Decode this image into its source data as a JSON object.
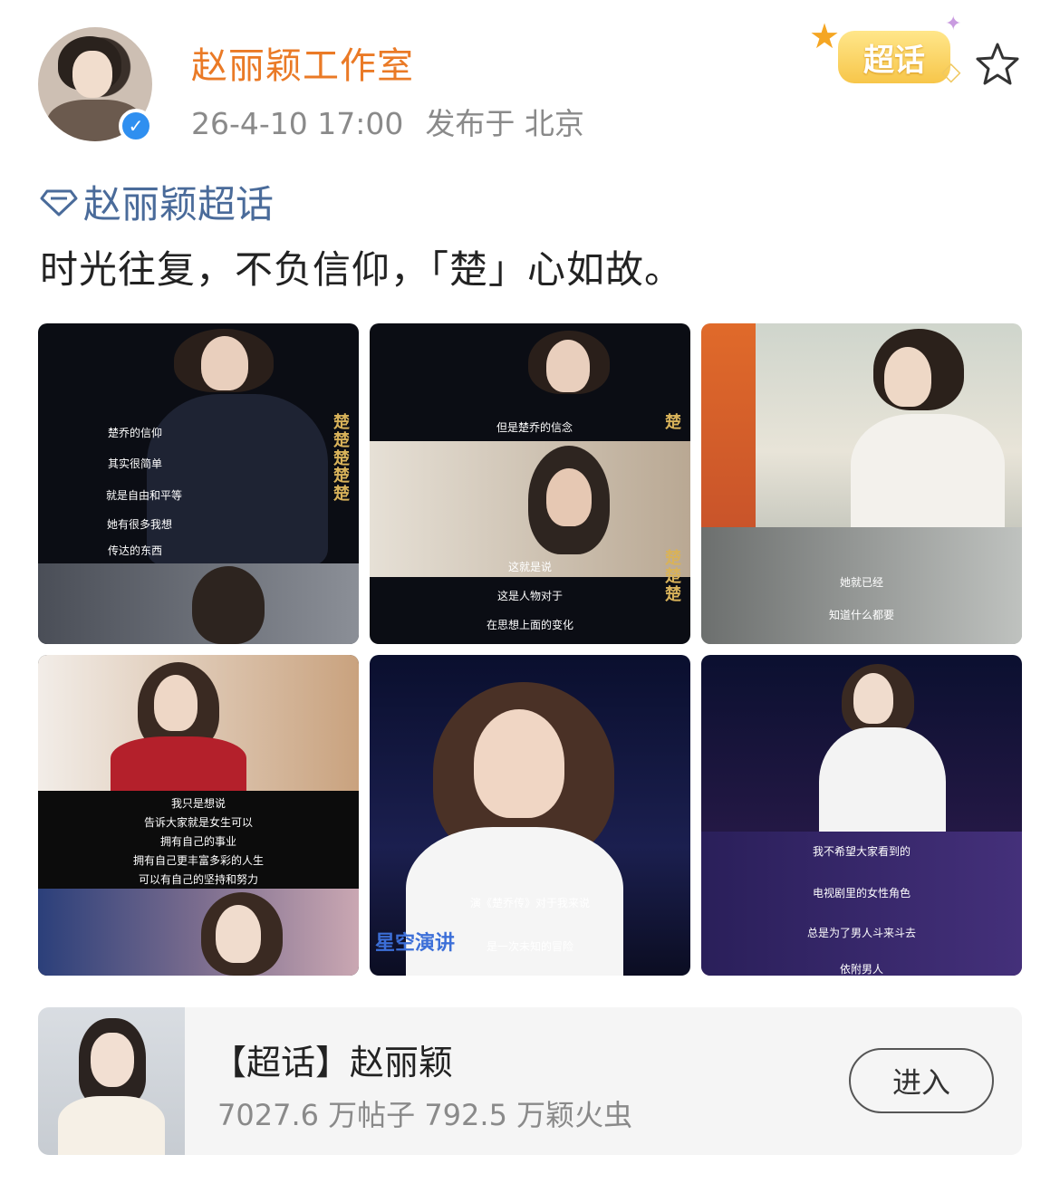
{
  "post": {
    "username": "赵丽颖工作室",
    "timestamp": "26-4-10 17:00",
    "location": "发布于 北京",
    "badge_label": "超话",
    "topic": "赵丽颖超话",
    "text": "时光往复，不负信仰，「楚」心如故。"
  },
  "images": [
    {
      "subtitles": [
        "楚乔的信仰",
        "其实很简单",
        "就是自由和平等",
        "她有很多我想",
        "传达的东西"
      ]
    },
    {
      "subtitles": [
        "但是楚乔的信念",
        "这就是说",
        "这是人物对于",
        "在思想上面的变化"
      ]
    },
    {
      "subtitles": [
        "她就已经",
        "知道什么都要"
      ]
    },
    {
      "subtitles": [
        "我只是想说",
        "告诉大家就是女生可以",
        "拥有自己的事业",
        "拥有自己更丰富多彩的人生",
        "可以有自己的坚持和努力"
      ]
    },
    {
      "subtitles": [
        "演《楚乔传》对于我来说",
        "是一次未知的冒险"
      ],
      "stage_text": "星空演讲"
    },
    {
      "subtitles": [
        "我不希望大家看到的",
        "电视剧里的女性角色",
        "总是为了男人斗来斗去",
        "依附男人"
      ]
    }
  ],
  "card": {
    "title": "【超话】赵丽颖",
    "stats": "7027.6 万帖子 792.5 万颖火虫",
    "enter_label": "进入"
  },
  "colors": {
    "username": "#ea7a26",
    "topic": "#4a6b9a",
    "verified": "#2f8ff0",
    "badge": "#f7c64a"
  }
}
